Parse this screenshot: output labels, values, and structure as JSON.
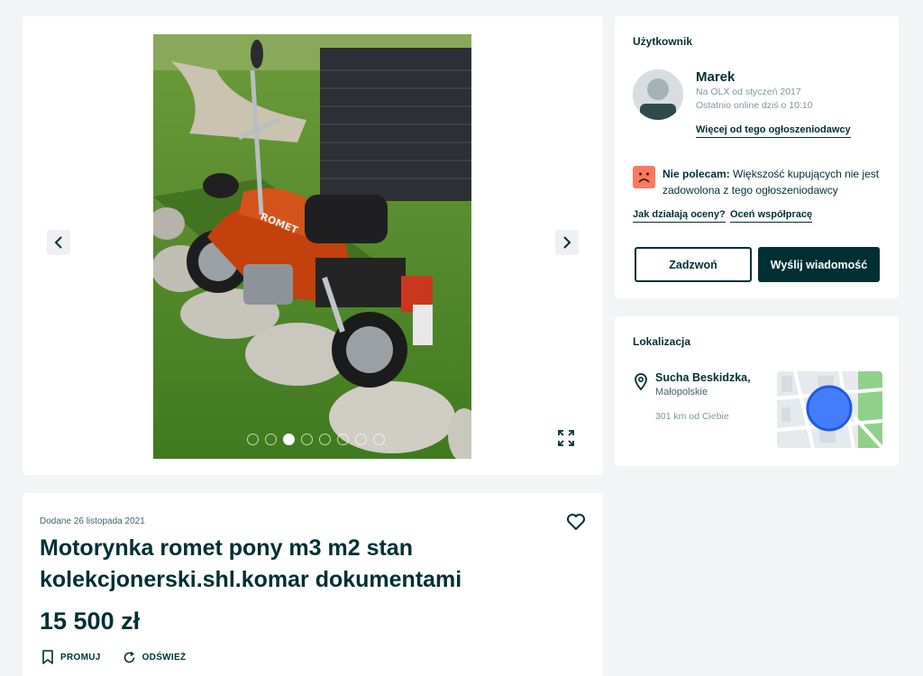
{
  "gallery": {
    "dot_count": 8,
    "active_dot_index": 2,
    "photo_brand_text": "ROMET"
  },
  "listing": {
    "added": "Dodane 26 listopada 2021",
    "title": "Motorynka romet pony m3 m2 stan kolekcjonerski.shl.komar dokumentami",
    "price": "15 500 zł",
    "promote_label": "PROMUJ",
    "refresh_label": "ODŚWIEŻ"
  },
  "user": {
    "heading": "Użytkownik",
    "name": "Marek",
    "since": "Na OLX od styczeń 2017",
    "last_online": "Ostatnio online dziś o 10:10",
    "more_link": "Więcej od tego ogłoszeniodawcy",
    "rating_strong": "Nie polecam:",
    "rating_text": " Większość kupujących nie jest zadowolona z tego ogłoszeniodawcy",
    "how_ratings_link": "Jak działają oceny?",
    "rate_link": "Oceń współpracę",
    "call_button": "Zadzwoń",
    "message_button": "Wyślij wiadomość"
  },
  "location": {
    "heading": "Lokalizacja",
    "city": "Sucha Beskidzka,",
    "region": "Małopolskie",
    "distance": "301 km od Ciebie"
  },
  "colors": {
    "primary": "#002f34",
    "background": "#f2f4f5",
    "negative_badge": "#f97a5e",
    "map_marker": "#3a77ff"
  }
}
